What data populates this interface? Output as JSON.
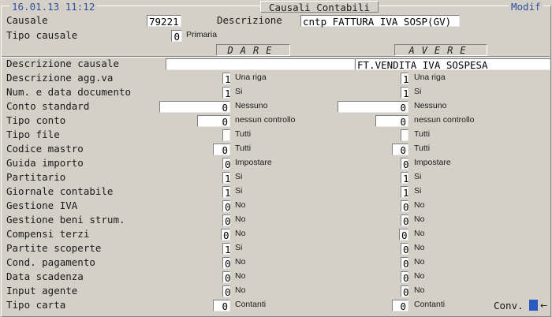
{
  "header": {
    "datetime": "16.01.13 11:12",
    "title": "Causali Contabili",
    "mode": "Modif"
  },
  "top": {
    "causale_label": "Causale",
    "causale_value": "79221",
    "descrizione_label": "Descrizione",
    "descrizione_value": "cntp FATTURA IVA SOSP(GV)",
    "tipo_label": "Tipo causale",
    "tipo_value": "0",
    "tipo_desc": "Primaria"
  },
  "columns": {
    "dare": "DARE",
    "avere": "AVERE"
  },
  "desc_causale": {
    "label": "Descrizione causale",
    "dare": "",
    "avere": "FT.VENDITA IVA SOSPESA"
  },
  "rows": [
    {
      "label": "Descrizione agg.va",
      "dv": "1",
      "dd": "Una riga",
      "av": "1",
      "ad": "Una riga"
    },
    {
      "label": "Num. e data documento",
      "dv": "1",
      "dd": "Si",
      "av": "1",
      "ad": "Si"
    },
    {
      "label": "Conto standard",
      "dv": "0",
      "dd": "Nessuno",
      "av": "0",
      "ad": "Nessuno"
    },
    {
      "label": "Tipo conto",
      "dv": "0",
      "dd": "nessun controllo",
      "av": "0",
      "ad": "nessun controllo"
    },
    {
      "label": "Tipo file",
      "dv": "",
      "dd": "Tutti",
      "av": "",
      "ad": "Tutti"
    },
    {
      "label": "Codice mastro",
      "dv": "0",
      "dd": "Tutti",
      "av": "0",
      "ad": "Tutti"
    },
    {
      "label": "Guida importo",
      "dv": "0",
      "dd": "Impostare",
      "av": "0",
      "ad": "Impostare"
    },
    {
      "label": "Partitario",
      "dv": "1",
      "dd": "Si",
      "av": "1",
      "ad": "Si"
    },
    {
      "label": "Giornale contabile",
      "dv": "1",
      "dd": "Si",
      "av": "1",
      "ad": "Si"
    },
    {
      "label": "Gestione IVA",
      "dv": "0",
      "dd": "No",
      "av": "0",
      "ad": "No"
    },
    {
      "label": "Gestione beni strum.",
      "dv": "0",
      "dd": "No",
      "av": "0",
      "ad": "No"
    },
    {
      "label": "Compensi terzi",
      "dv": "0",
      "dd": "No",
      "av": "0",
      "ad": "No"
    },
    {
      "label": "Partite scoperte",
      "dv": "1",
      "dd": "Si",
      "av": "0",
      "ad": "No"
    },
    {
      "label": "Cond. pagamento",
      "dv": "0",
      "dd": "No",
      "av": "0",
      "ad": "No"
    },
    {
      "label": "Data scadenza",
      "dv": "0",
      "dd": "No",
      "av": "0",
      "ad": "No"
    },
    {
      "label": "Input agente",
      "dv": "0",
      "dd": "No",
      "av": "0",
      "ad": "No"
    },
    {
      "label": "Tipo carta",
      "dv": "0",
      "dd": "Contanti",
      "av": "0",
      "ad": "Contanti"
    }
  ],
  "footer": {
    "conv_label": "Conv.",
    "arrow": "←"
  }
}
